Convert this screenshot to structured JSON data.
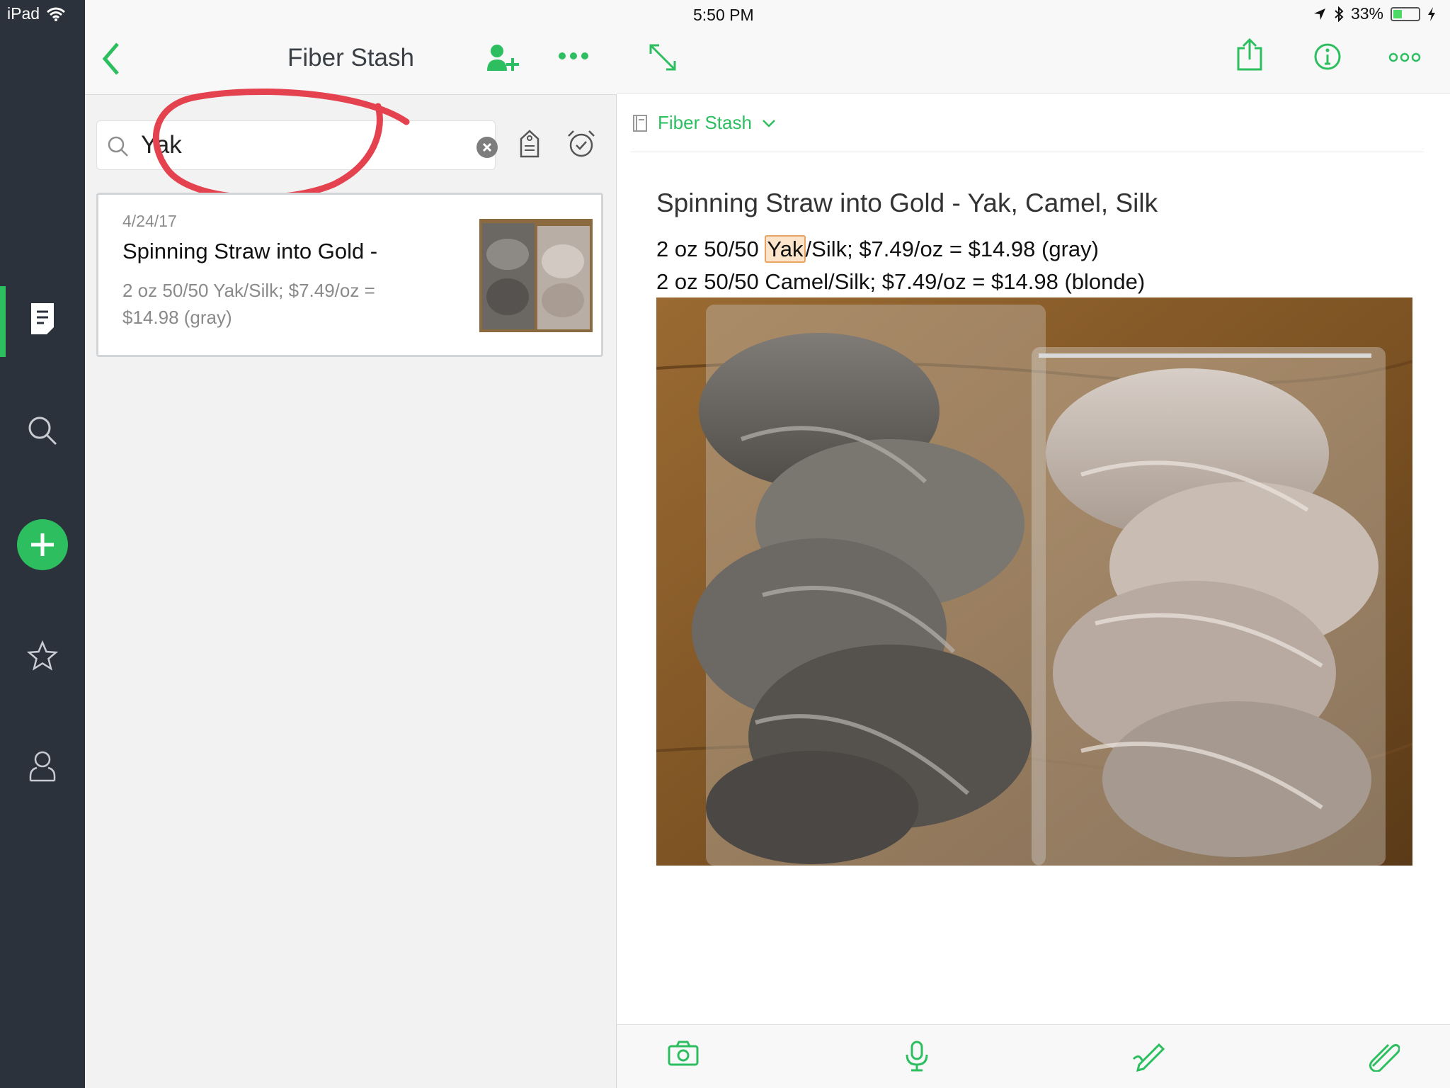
{
  "status_bar": {
    "device": "iPad",
    "time": "5:50 PM",
    "battery": "33%"
  },
  "sidebar": {
    "items": [
      {
        "name": "notes",
        "icon": "note-icon",
        "active": true
      },
      {
        "name": "search",
        "icon": "search-icon"
      },
      {
        "name": "new-note",
        "icon": "plus-icon"
      },
      {
        "name": "shortcuts",
        "icon": "star-icon"
      },
      {
        "name": "account",
        "icon": "person-icon"
      }
    ]
  },
  "list": {
    "title": "Fiber Stash",
    "search_value": "Yak",
    "notes": [
      {
        "date": "4/24/17",
        "title": "Spinning Straw into Gold -",
        "snippet": "2 oz 50/50 Yak/Silk; $7.49/oz = $14.98 (gray)"
      }
    ]
  },
  "note": {
    "notebook": "Fiber Stash",
    "title": "Spinning Straw into Gold - Yak, Camel, Silk",
    "line1_pre": "2 oz 50/50 ",
    "line1_match": "Yak",
    "line1_post": "/Silk; $7.49/oz = $14.98 (gray)",
    "line2": "2 oz 50/50 Camel/Silk; $7.49/oz = $14.98 (blonde)"
  },
  "colors": {
    "accent": "#2dbe60",
    "rail": "#2b323c",
    "annotation": "#e5424f",
    "highlight": "#fbe4c9"
  }
}
